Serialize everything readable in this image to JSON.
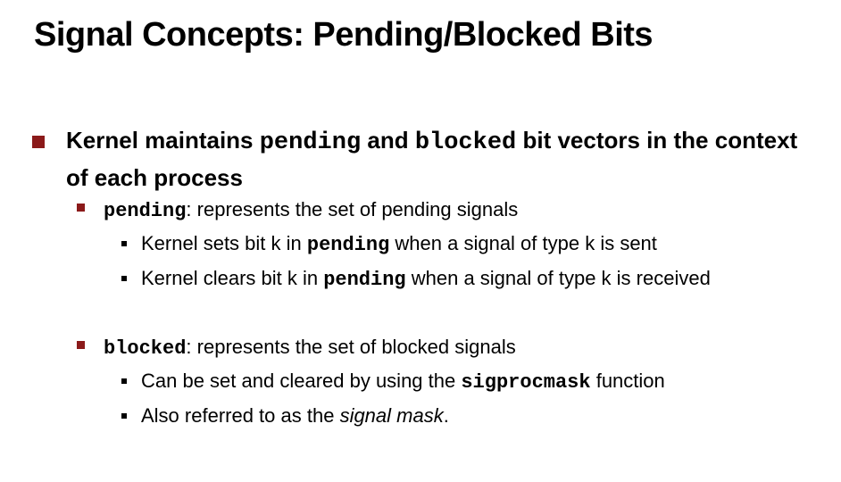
{
  "title": "Signal Concepts: Pending/Blocked Bits",
  "bullet1": {
    "t1": "Kernel maintains ",
    "c1": "pending",
    "t2": " and ",
    "c2": "blocked",
    "t3": " bit vectors in the context of each process"
  },
  "pending": {
    "code": "pending",
    "desc": ": represents the set of pending signals",
    "items": [
      {
        "pre": "Kernel sets bit k in ",
        "code": "pending",
        "post": " when a signal of type k is sent"
      },
      {
        "pre": "Kernel clears bit k in ",
        "code": "pending",
        "post": " when a signal of type k is received"
      }
    ]
  },
  "blocked": {
    "code": "blocked",
    "desc": ": represents the set of blocked signals",
    "item1": {
      "pre": "Can be set and cleared by using the ",
      "code": "sigprocmask",
      "post": " function"
    },
    "item2": {
      "pre": "Also referred to as the ",
      "em": "signal mask",
      "post": "."
    }
  },
  "colors": {
    "bullet_l1": "#8b1a1a",
    "bullet_l2": "#8b1a1a",
    "bullet_l3": "#000000"
  }
}
